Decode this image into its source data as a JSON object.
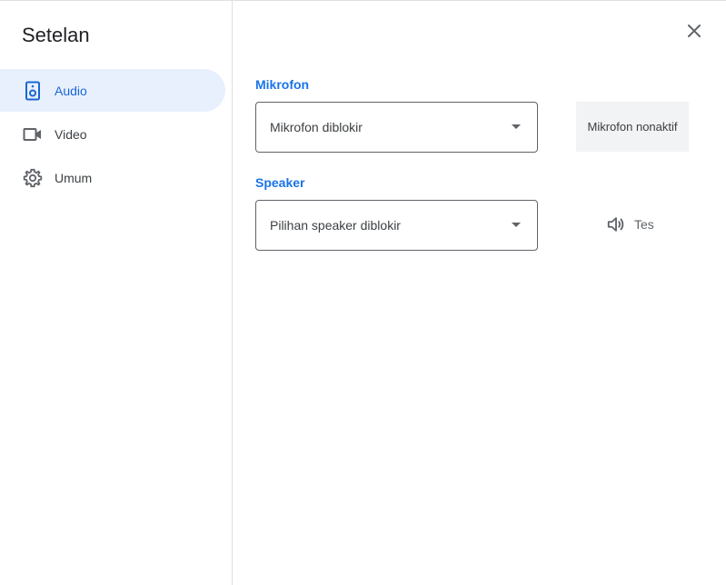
{
  "dialog": {
    "title": "Setelan"
  },
  "sidebar": {
    "items": [
      {
        "label": "Audio",
        "icon": "speaker-icon",
        "active": true
      },
      {
        "label": "Video",
        "icon": "videocam-icon",
        "active": false
      },
      {
        "label": "Umum",
        "icon": "gear-icon",
        "active": false
      }
    ]
  },
  "microphone": {
    "label": "Mikrofon",
    "selected": "Mikrofon diblokir",
    "status": "Mikrofon nonaktif"
  },
  "speaker": {
    "label": "Speaker",
    "selected": "Pilihan speaker diblokir",
    "test_label": "Tes"
  },
  "colors": {
    "accent": "#1a73e8",
    "active_bg": "#e8f0fe",
    "active_text": "#1967d2",
    "text": "#3c4043"
  }
}
